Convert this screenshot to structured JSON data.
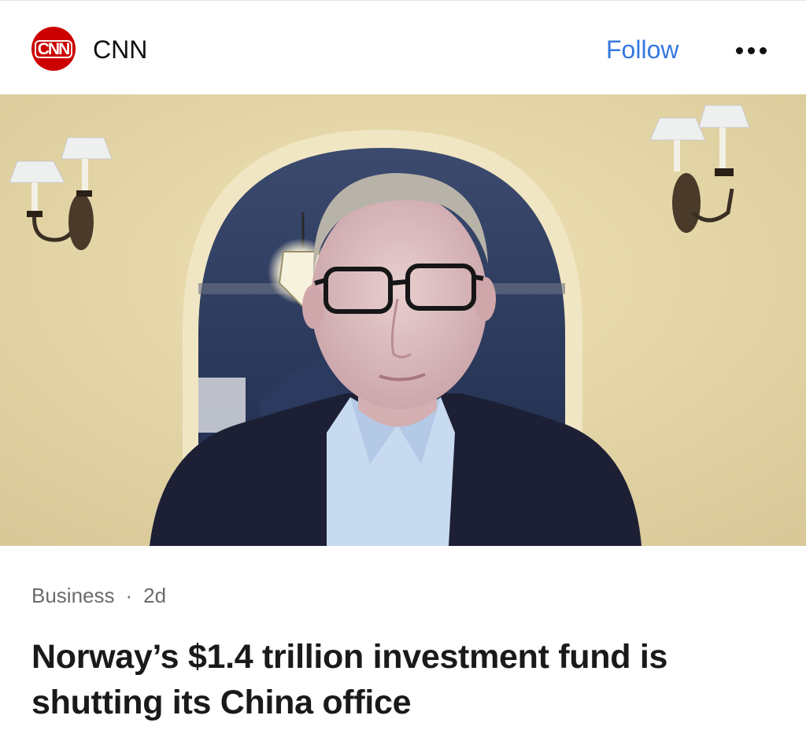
{
  "header": {
    "logo_text": "CNN",
    "source_name": "CNN",
    "follow_label": "Follow",
    "more_icon": "more-horizontal-icon"
  },
  "image": {
    "description_subject": "man-in-video-call"
  },
  "article": {
    "category": "Business",
    "separator": "·",
    "age": "2d",
    "headline": "Norway’s $1.4 trillion investment fund is shutting its China office"
  },
  "colors": {
    "brand_red": "#cc0000",
    "follow_blue": "#3478e0",
    "headline": "#1a1a1a",
    "meta": "#6b6b6b"
  }
}
